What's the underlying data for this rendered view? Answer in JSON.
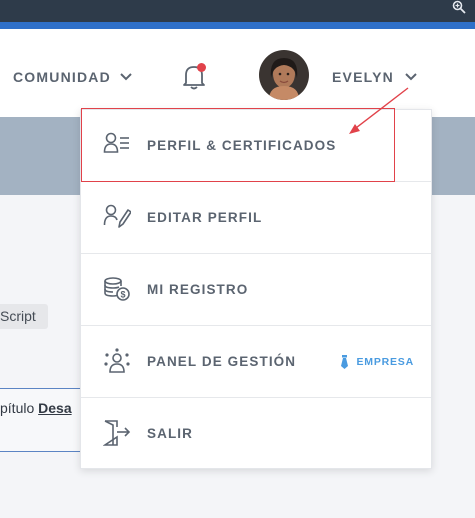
{
  "header": {
    "nav_comunidad": "COMUNIDAD",
    "user_name": "EVELYN"
  },
  "menu": {
    "items": [
      {
        "label": "PERFIL & CERTIFICADOS",
        "icon": "profile-certificates-icon"
      },
      {
        "label": "EDITAR PERFIL",
        "icon": "edit-profile-icon"
      },
      {
        "label": "MI REGISTRO",
        "icon": "coins-icon"
      },
      {
        "label": "PANEL DE GESTIÓN",
        "icon": "team-icon",
        "badge": "EMPRESA"
      },
      {
        "label": "SALIR",
        "icon": "logout-icon"
      }
    ]
  },
  "background": {
    "chip_text": "Script",
    "chapter_prefix": "pítulo ",
    "chapter_link": "Desa"
  },
  "colors": {
    "topbar": "#2e3b4a",
    "accent": "#2f70c9",
    "highlight": "#e1424a",
    "badge": "#4a9be0",
    "notification": "#e1424a"
  }
}
